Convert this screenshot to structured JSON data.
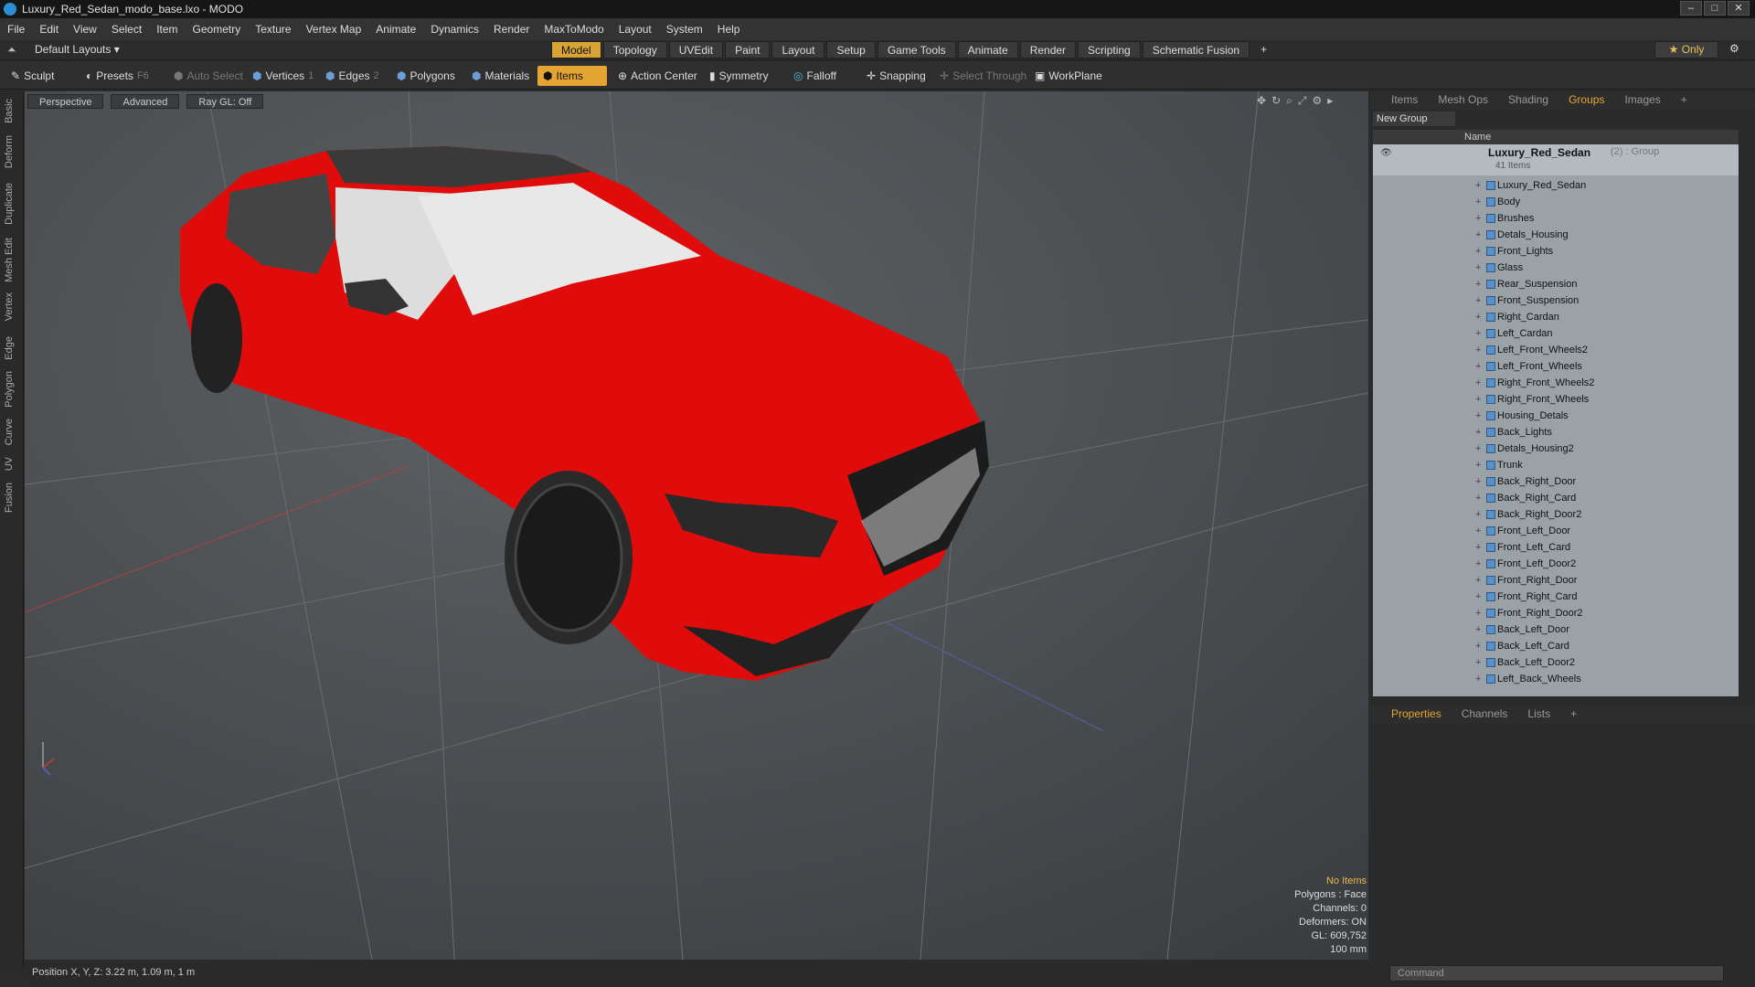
{
  "window": {
    "title": "Luxury_Red_Sedan_modo_base.lxo - MODO"
  },
  "menu": [
    "File",
    "Edit",
    "View",
    "Select",
    "Item",
    "Geometry",
    "Texture",
    "Vertex Map",
    "Animate",
    "Dynamics",
    "Render",
    "MaxToModo",
    "Layout",
    "System",
    "Help"
  ],
  "layout": {
    "dropdown": "Default Layouts",
    "tabs": [
      "Model",
      "Topology",
      "UVEdit",
      "Paint",
      "Layout",
      "Setup",
      "Game Tools",
      "Animate",
      "Render",
      "Scripting",
      "Schematic Fusion"
    ],
    "active_tab": "Model",
    "only_label": "Only"
  },
  "toolbar": {
    "sculpt": "Sculpt",
    "presets": "Presets",
    "presets_key": "F6",
    "auto_select": "Auto Select",
    "vertices": "Vertices",
    "vertices_key": "1",
    "edges": "Edges",
    "edges_key": "2",
    "polygons": "Polygons",
    "materials": "Materials",
    "items": "Items",
    "action_center": "Action Center",
    "symmetry": "Symmetry",
    "falloff": "Falloff",
    "snapping": "Snapping",
    "select_through": "Select Through",
    "workplane": "WorkPlane"
  },
  "left_tabs": [
    "Basic",
    "Deform",
    "Duplicate",
    "Mesh Edit",
    "Vertex",
    "Edge",
    "Polygon",
    "Curve",
    "UV",
    "Fusion"
  ],
  "viewport": {
    "view": "Perspective",
    "mode": "Advanced",
    "raygl": "Ray GL: Off",
    "hud": {
      "items": "No Items",
      "polygons": "Polygons : Face",
      "channels": "Channels: 0",
      "deformers": "Deformers: ON",
      "gl": "GL: 609,752",
      "scale": "100 mm"
    }
  },
  "status": {
    "position": "Position X, Y, Z:  3.22 m, 1.09 m, 1 m"
  },
  "panel": {
    "tabs": [
      "Items",
      "Mesh Ops",
      "Shading",
      "Groups",
      "Images"
    ],
    "active_tab": "Groups",
    "new_group": "New Group",
    "name_header": "Name",
    "group": {
      "name": "Luxury_Red_Sedan",
      "count": "(2)",
      "type": ": Group",
      "items_count": "41 Items"
    },
    "items": [
      "Luxury_Red_Sedan",
      "Body",
      "Brushes",
      "Detals_Housing",
      "Front_Lights",
      "Glass",
      "Rear_Suspension",
      "Front_Suspension",
      "Right_Cardan",
      "Left_Cardan",
      "Left_Front_Wheels2",
      "Left_Front_Wheels",
      "Right_Front_Wheels2",
      "Right_Front_Wheels",
      "Housing_Detals",
      "Back_Lights",
      "Detals_Housing2",
      "Trunk",
      "Back_Right_Door",
      "Back_Right_Card",
      "Back_Right_Door2",
      "Front_Left_Door",
      "Front_Left_Card",
      "Front_Left_Door2",
      "Front_Right_Door",
      "Front_Right_Card",
      "Front_Right_Door2",
      "Back_Left_Door",
      "Back_Left_Card",
      "Back_Left_Door2",
      "Left_Back_Wheels"
    ],
    "bottom_tabs": [
      "Properties",
      "Channels",
      "Lists"
    ],
    "bottom_active": "Properties",
    "command_placeholder": "Command"
  },
  "colors": {
    "accent": "#e4a532",
    "car": "#e00b0b",
    "viewport": "#4d5053"
  }
}
